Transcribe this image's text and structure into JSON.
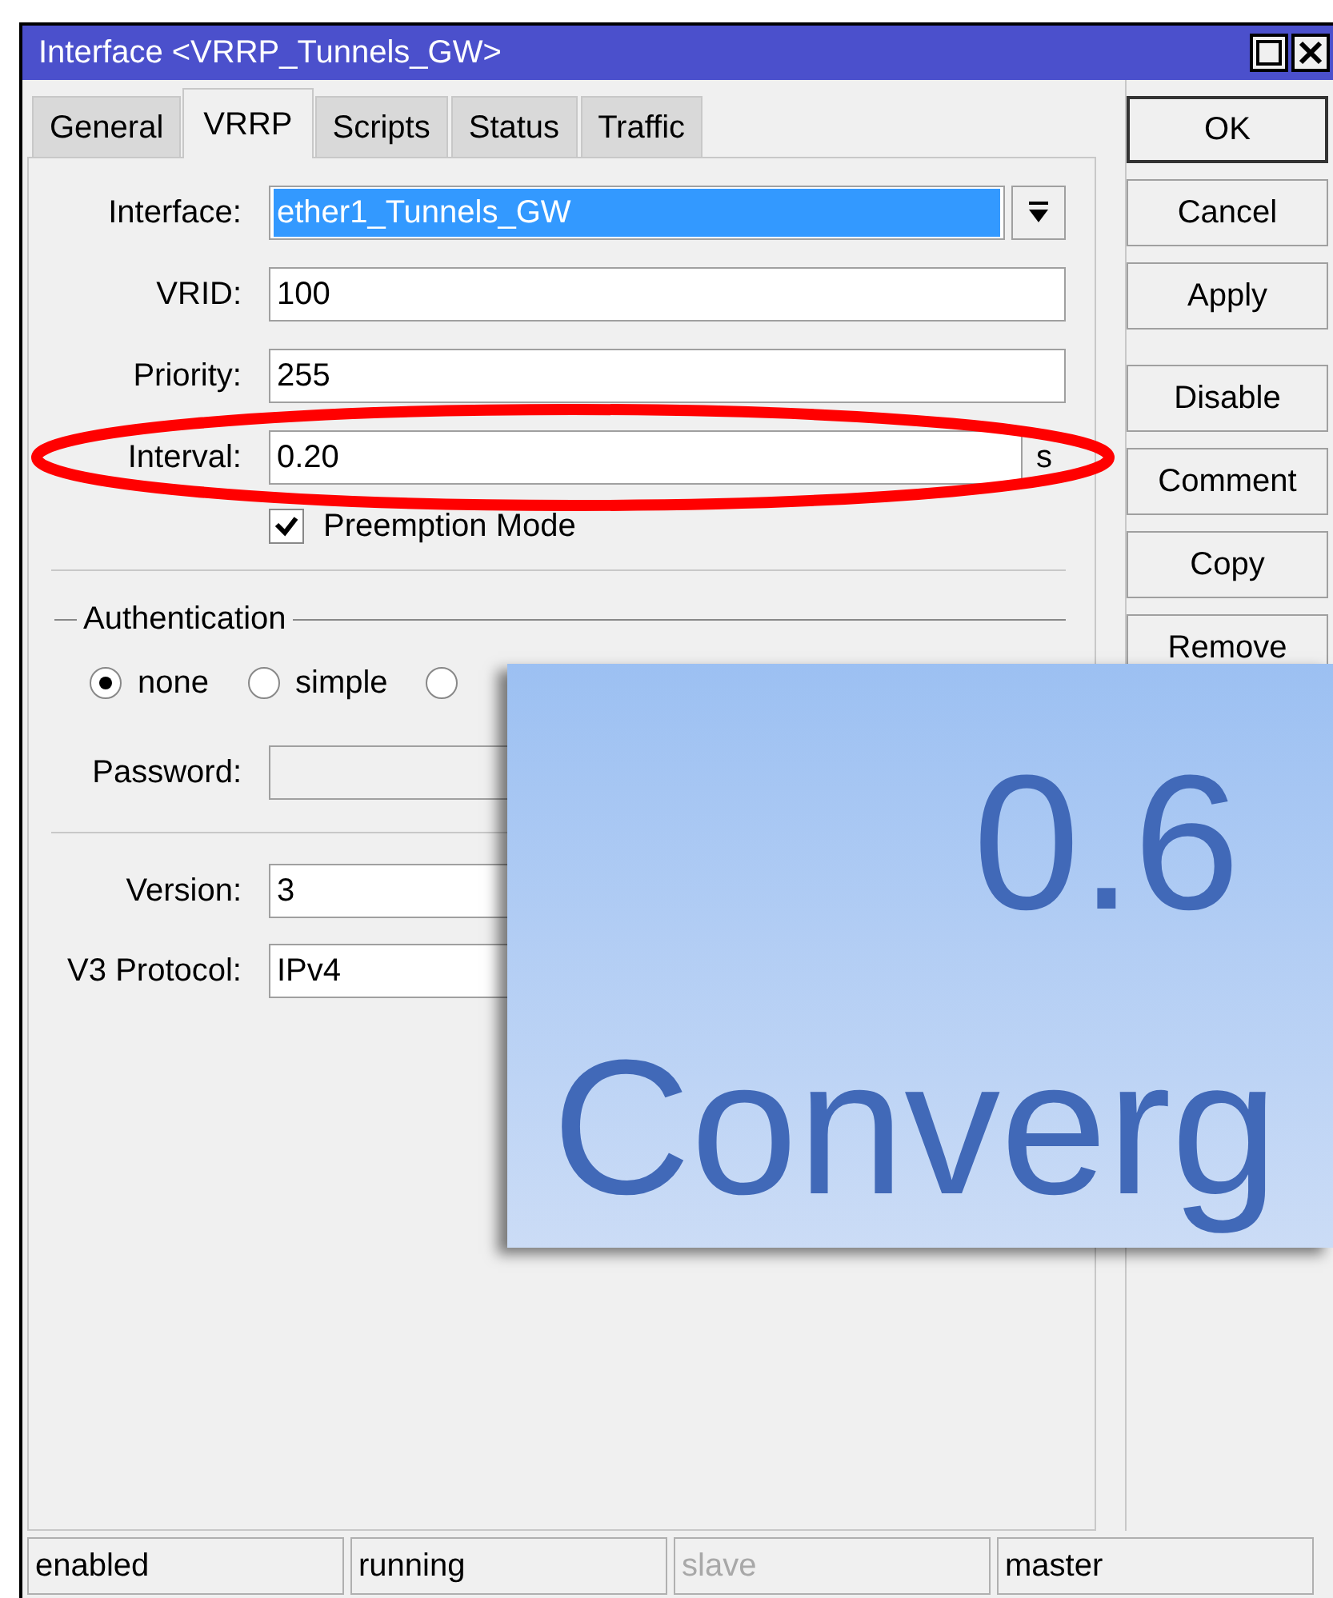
{
  "window": {
    "title": "Interface <VRRP_Tunnels_GW>"
  },
  "tabs": [
    {
      "label": "General",
      "selected": false
    },
    {
      "label": "VRRP",
      "selected": true
    },
    {
      "label": "Scripts",
      "selected": false
    },
    {
      "label": "Status",
      "selected": false
    },
    {
      "label": "Traffic",
      "selected": false
    }
  ],
  "fields": [
    {
      "kind": "combo",
      "label": "Interface:",
      "value": "ether1_Tunnels_GW",
      "text_selected": true
    },
    {
      "kind": "text",
      "label": "VRID:",
      "value": "100"
    },
    {
      "kind": "text",
      "label": "Priority:",
      "value": "255"
    },
    {
      "kind": "text",
      "label": "Interval:",
      "value": "0.20",
      "unit": "s"
    },
    {
      "kind": "checkbox",
      "label": "Preemption Mode",
      "checked": true
    }
  ],
  "authentication": {
    "title": "Authentication",
    "options": [
      {
        "label": "none",
        "selected": true
      },
      {
        "label": "simple",
        "selected": false
      },
      {
        "selected": false
      }
    ]
  },
  "password": {
    "label": "Password:",
    "disabled": true
  },
  "version_fields": [
    {
      "label": "Version:",
      "value": "3"
    },
    {
      "label": "V3 Protocol:",
      "value": "IPv4"
    }
  ],
  "buttons": [
    {
      "label": "OK",
      "default": true
    },
    {
      "label": "Cancel",
      "default": false
    },
    {
      "label": "Apply",
      "default": false
    },
    {
      "label": "Disable",
      "default": false
    },
    {
      "label": "Comment",
      "default": false
    },
    {
      "label": "Copy",
      "default": false
    },
    {
      "label": "Remove",
      "default": false
    }
  ],
  "status_bar": [
    {
      "text": "enabled",
      "disabled": false
    },
    {
      "text": "running",
      "disabled": false
    },
    {
      "text": "slave",
      "disabled": true
    },
    {
      "text": "master",
      "disabled": false
    }
  ],
  "overlay": {
    "heading": "0.6",
    "subheading": "Converg"
  }
}
